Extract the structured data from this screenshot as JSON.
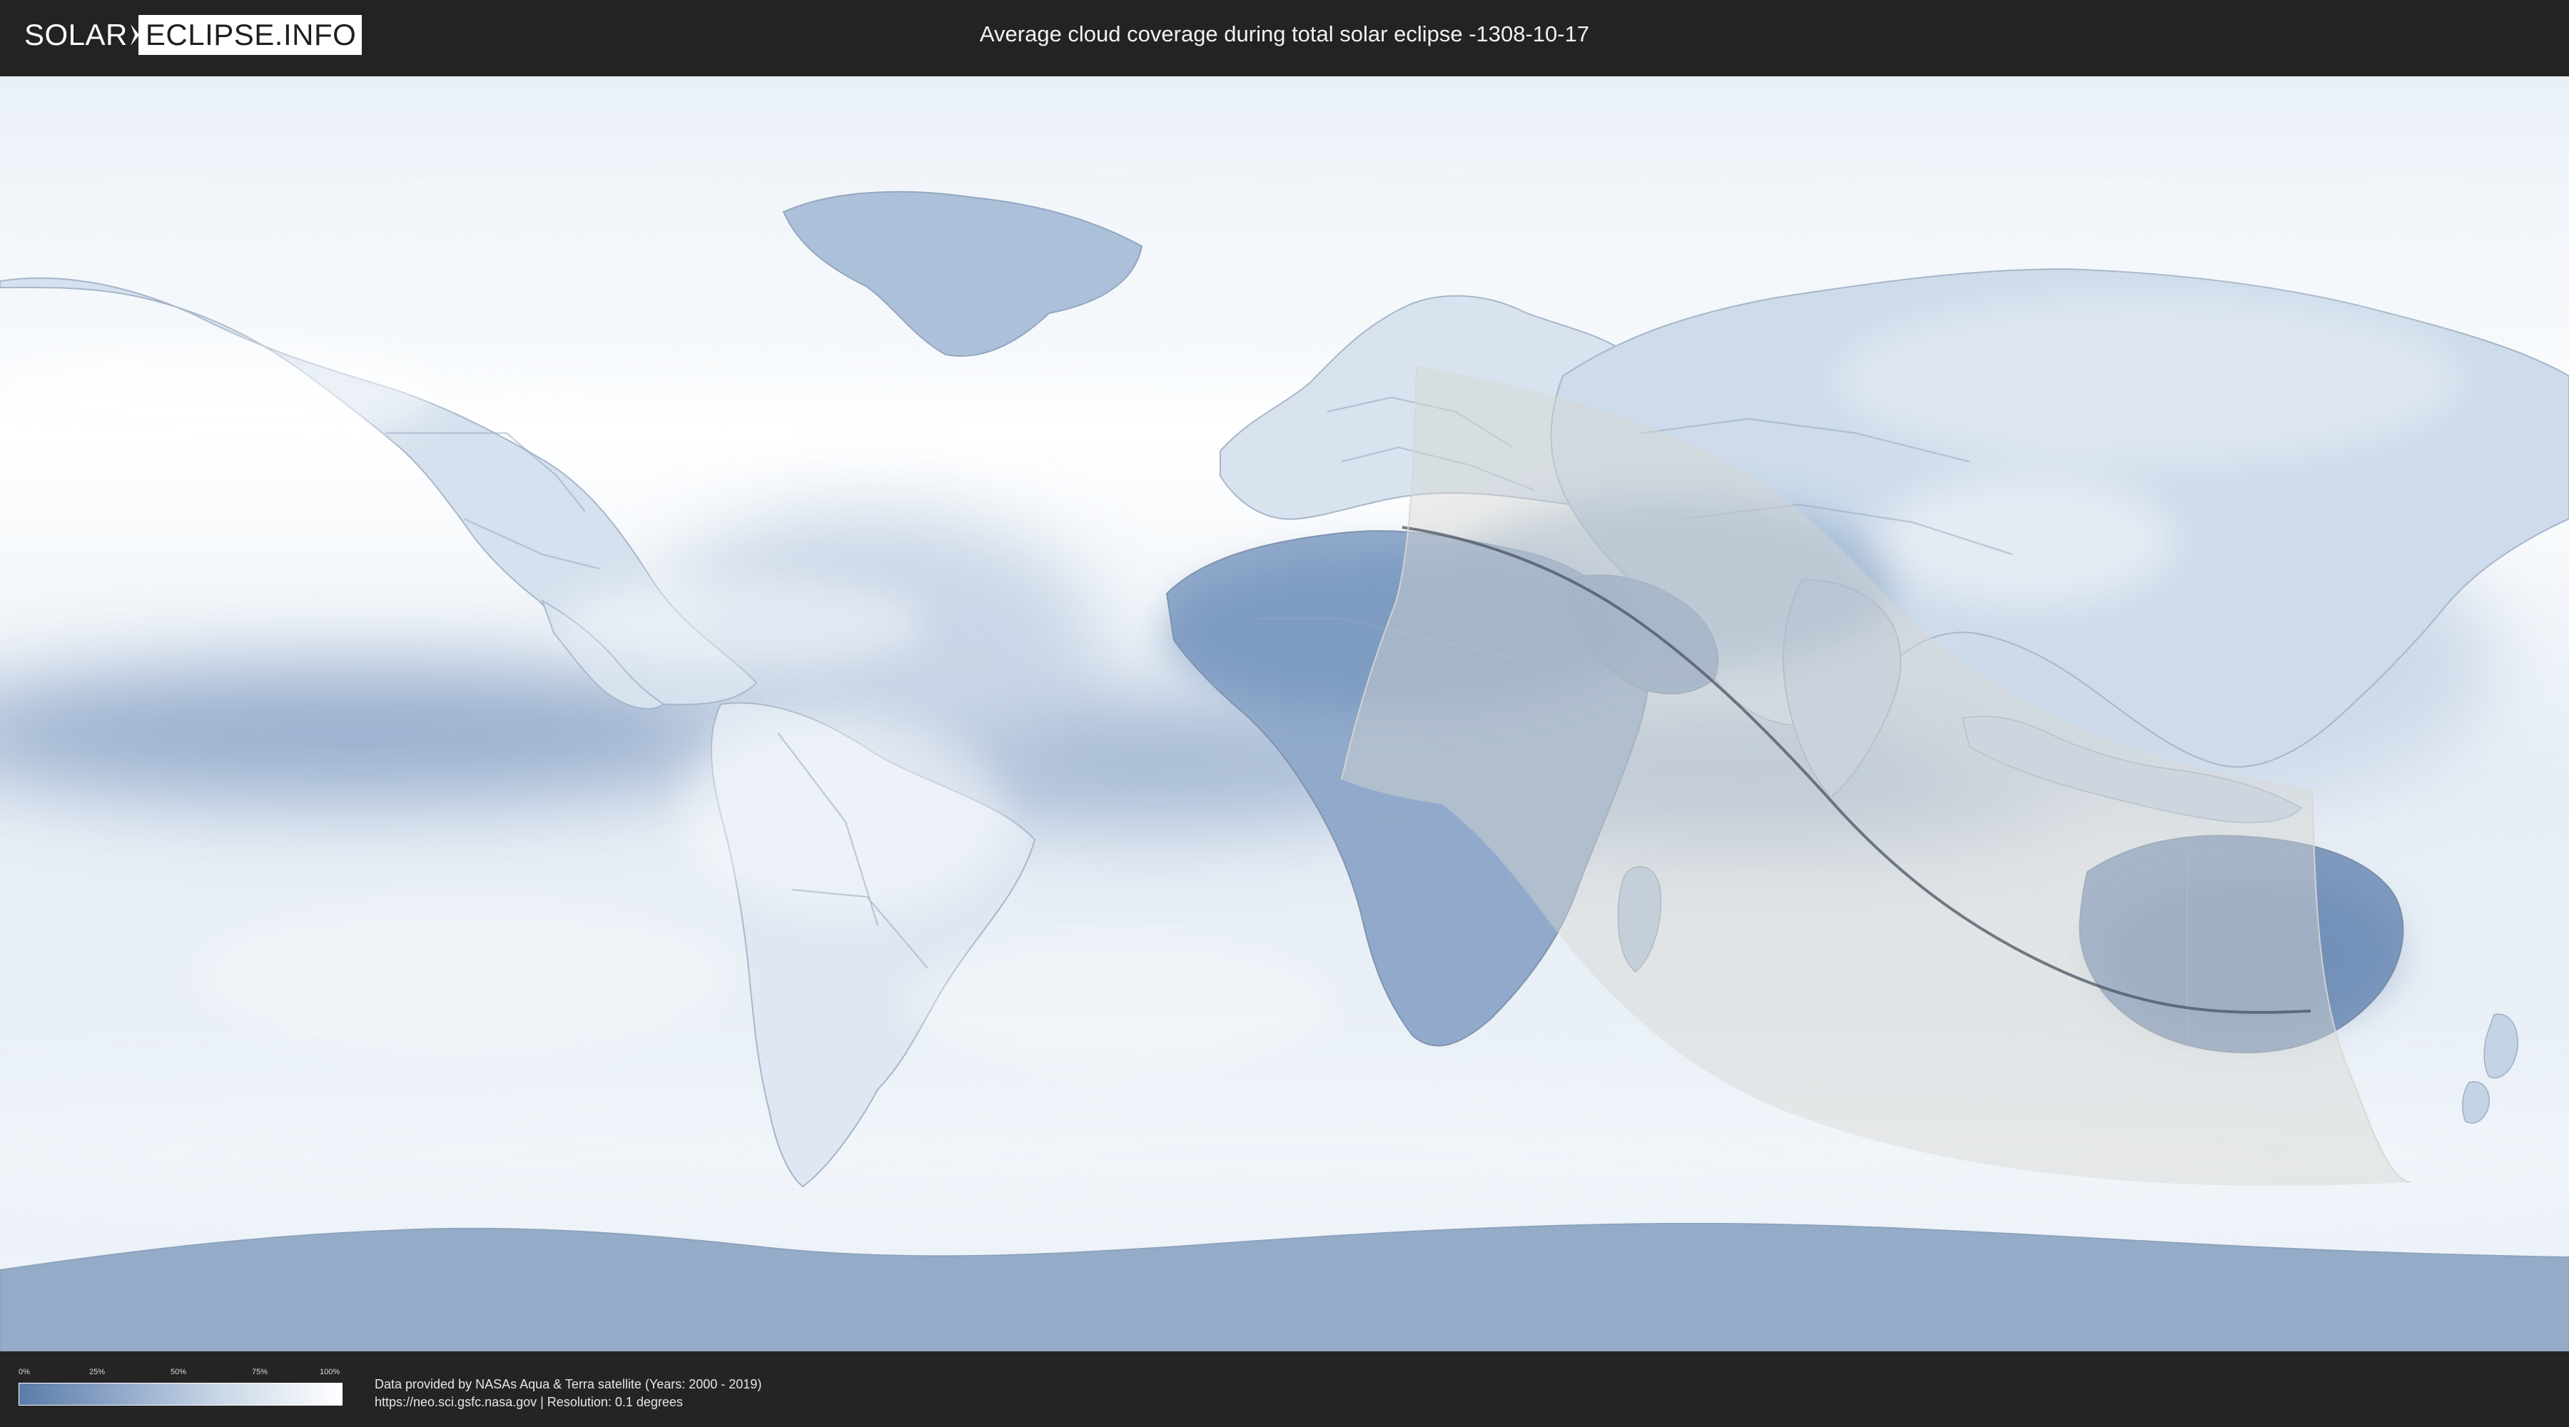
{
  "header": {
    "logo_left": "SOLAR",
    "logo_right": "ECLIPSE.INFO",
    "title": "Average cloud coverage during total solar eclipse -1308-10-17"
  },
  "legend": {
    "labels": [
      "0%",
      "25%",
      "50%",
      "75%",
      "100%"
    ],
    "gradient_colors": [
      "#5b7ba8",
      "#8fa7c8",
      "#c9d7e7",
      "#ffffff"
    ]
  },
  "credits": {
    "line_1": "Data provided by NASAs Aqua & Terra satellite (Years: 2000 - 2019)",
    "line_2": "https://neo.sci.gsfc.nasa.gov | Resolution: 0.1 degrees"
  },
  "map": {
    "projection": "equirectangular",
    "eclipse_type": "total solar eclipse",
    "eclipse_date": "-1308-10-17",
    "visible_regions": [
      "North America",
      "South America",
      "Greenland",
      "Europe",
      "Africa",
      "Asia",
      "Australia",
      "Antarctica"
    ],
    "colors": {
      "low_cloud_blue": "#5b7ba8",
      "mid_cloud_blue": "#8fa7c8",
      "high_cloud_white": "#ffffff",
      "eclipse_shadow_fill": "#d8d6d2",
      "eclipse_centerline": "#4a5363"
    }
  }
}
